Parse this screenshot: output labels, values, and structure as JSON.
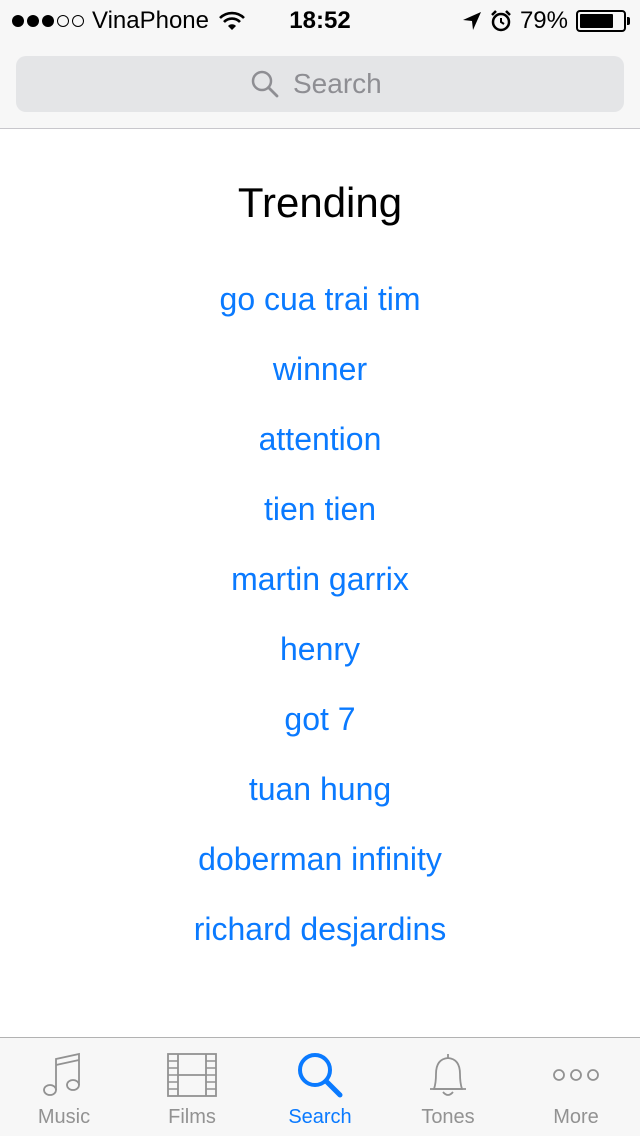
{
  "status_bar": {
    "carrier": "VinaPhone",
    "time": "18:52",
    "battery": "79%",
    "battery_level": 0.79,
    "signal_bars_filled": 3,
    "signal_bars_total": 5
  },
  "search": {
    "placeholder": "Search"
  },
  "trending": {
    "title": "Trending",
    "items": [
      "go cua trai tim",
      "winner",
      "attention",
      "tien tien",
      "martin garrix",
      "henry",
      "got 7",
      "tuan hung",
      "doberman infinity",
      "richard desjardins"
    ]
  },
  "tab_bar": {
    "tabs": [
      {
        "label": "Music",
        "icon": "music-note-icon",
        "active": false
      },
      {
        "label": "Films",
        "icon": "film-icon",
        "active": false
      },
      {
        "label": "Search",
        "icon": "search-icon",
        "active": true
      },
      {
        "label": "Tones",
        "icon": "bell-icon",
        "active": false
      },
      {
        "label": "More",
        "icon": "more-icon",
        "active": false
      }
    ]
  },
  "colors": {
    "accent": "#0a7aff",
    "inactive": "#929292",
    "bar_background": "#f7f7f7"
  }
}
